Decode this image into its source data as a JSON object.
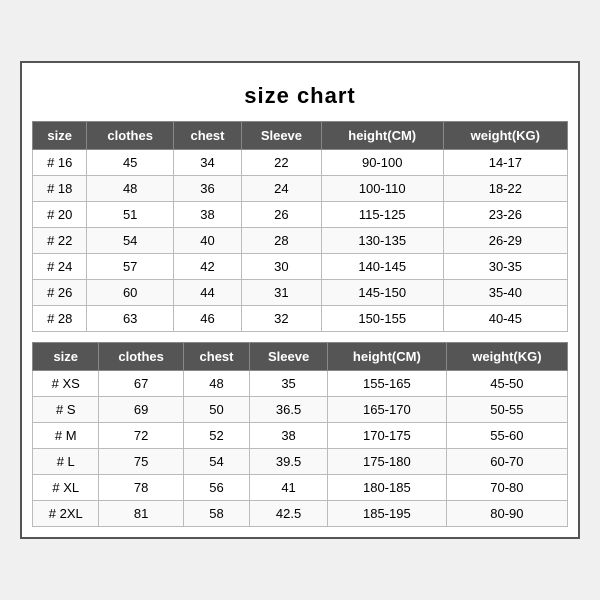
{
  "title": "size chart",
  "table1": {
    "headers": [
      "size",
      "clothes",
      "chest",
      "Sleeve",
      "height(CM)",
      "weight(KG)"
    ],
    "rows": [
      [
        "# 16",
        "45",
        "34",
        "22",
        "90-100",
        "14-17"
      ],
      [
        "# 18",
        "48",
        "36",
        "24",
        "100-110",
        "18-22"
      ],
      [
        "# 20",
        "51",
        "38",
        "26",
        "115-125",
        "23-26"
      ],
      [
        "# 22",
        "54",
        "40",
        "28",
        "130-135",
        "26-29"
      ],
      [
        "# 24",
        "57",
        "42",
        "30",
        "140-145",
        "30-35"
      ],
      [
        "# 26",
        "60",
        "44",
        "31",
        "145-150",
        "35-40"
      ],
      [
        "# 28",
        "63",
        "46",
        "32",
        "150-155",
        "40-45"
      ]
    ]
  },
  "table2": {
    "headers": [
      "size",
      "clothes",
      "chest",
      "Sleeve",
      "height(CM)",
      "weight(KG)"
    ],
    "rows": [
      [
        "# XS",
        "67",
        "48",
        "35",
        "155-165",
        "45-50"
      ],
      [
        "# S",
        "69",
        "50",
        "36.5",
        "165-170",
        "50-55"
      ],
      [
        "# M",
        "72",
        "52",
        "38",
        "170-175",
        "55-60"
      ],
      [
        "# L",
        "75",
        "54",
        "39.5",
        "175-180",
        "60-70"
      ],
      [
        "# XL",
        "78",
        "56",
        "41",
        "180-185",
        "70-80"
      ],
      [
        "# 2XL",
        "81",
        "58",
        "42.5",
        "185-195",
        "80-90"
      ]
    ]
  }
}
